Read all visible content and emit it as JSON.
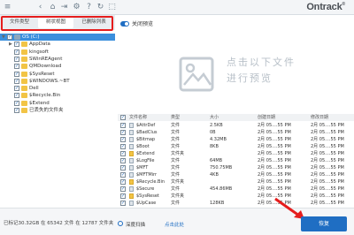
{
  "brand": {
    "name": "Ontrack",
    "reg": "®"
  },
  "toolbar": {
    "icons": [
      "menu-icon",
      "back-icon",
      "home-icon",
      "forward-icon",
      "settings-icon",
      "help-icon",
      "refresh-icon",
      "maximize-icon"
    ]
  },
  "left": {
    "tabs": [
      "文件类型",
      "树状视图",
      "已删除列表"
    ],
    "active_tab": 1,
    "tree": [
      {
        "label": "OS (C:)",
        "level": 0,
        "selected": true,
        "expanded": true,
        "drive": true
      },
      {
        "label": "AppData",
        "level": 1
      },
      {
        "label": "kingsoft",
        "level": 1
      },
      {
        "label": "SWinREAgent",
        "level": 1
      },
      {
        "label": "QMDownload",
        "level": 1
      },
      {
        "label": "$SysReset",
        "level": 1
      },
      {
        "label": "$WINDOWS.~BT",
        "level": 1
      },
      {
        "label": "Dell",
        "level": 1
      },
      {
        "label": "$Recycle.Bin",
        "level": 1
      },
      {
        "label": "$Extend",
        "level": 1
      },
      {
        "label": "已丢失的文件夹",
        "level": 1
      }
    ]
  },
  "status": {
    "text": "已标记30.32GB 在 65342 文件 在 12787 文件夹"
  },
  "right": {
    "preview_toggle": "关闭预览",
    "preview_hint": "点击以下文件进行预览",
    "columns": [
      "文件名称",
      "类型",
      "大小",
      "创建日期",
      "修改日期"
    ],
    "rows": [
      {
        "name": "$AttrDef",
        "type": "文件",
        "size": "2.5KB",
        "created": "2月 05....55 PM",
        "modified": "2月 05....55 PM",
        "folder": false
      },
      {
        "name": "$BadClus",
        "type": "文件",
        "size": "0B",
        "created": "2月 05....55 PM",
        "modified": "2月 05....55 PM",
        "folder": false
      },
      {
        "name": "$Bitmap",
        "type": "文件",
        "size": "4.32MB",
        "created": "2月 05....55 PM",
        "modified": "2月 05....55 PM",
        "folder": false
      },
      {
        "name": "$Boot",
        "type": "文件",
        "size": "8KB",
        "created": "2月 05....55 PM",
        "modified": "2月 05....55 PM",
        "folder": false
      },
      {
        "name": "$Extend",
        "type": "文件夹",
        "size": "",
        "created": "2月 05....55 PM",
        "modified": "2月 05....55 PM",
        "folder": true
      },
      {
        "name": "$LogFile",
        "type": "文件",
        "size": "64MB",
        "created": "2月 05....55 PM",
        "modified": "2月 05....55 PM",
        "folder": false
      },
      {
        "name": "$MFT",
        "type": "文件",
        "size": "750.75MB",
        "created": "2月 05....55 PM",
        "modified": "2月 05....55 PM",
        "folder": false
      },
      {
        "name": "$MFTMirr",
        "type": "文件",
        "size": "4KB",
        "created": "2月 05....55 PM",
        "modified": "2月 05....55 PM",
        "folder": false
      },
      {
        "name": "$Recycle.Bin",
        "type": "文件夹",
        "size": "",
        "created": "2月 05....55 PM",
        "modified": "2月 05....55 PM",
        "folder": true
      },
      {
        "name": "$Secure",
        "type": "文件",
        "size": "454.86MB",
        "created": "2月 05....55 PM",
        "modified": "2月 05....55 PM",
        "folder": false
      },
      {
        "name": "$SysReset",
        "type": "文件夹",
        "size": "",
        "created": "2月 05....55 PM",
        "modified": "2月 05....55 PM",
        "folder": true
      },
      {
        "name": "$UpCase",
        "type": "文件",
        "size": "128KB",
        "created": "2月 05....55 PM",
        "modified": "2月 05....55 PM",
        "folder": false
      }
    ]
  },
  "footer": {
    "deep_scan": "深度扫描",
    "deep_scan_link": "点击此处",
    "recover": "恢复"
  },
  "colors": {
    "accent": "#1f6ec3",
    "highlight": "#e51d1d",
    "tree_selected": "#3b8fdd"
  }
}
